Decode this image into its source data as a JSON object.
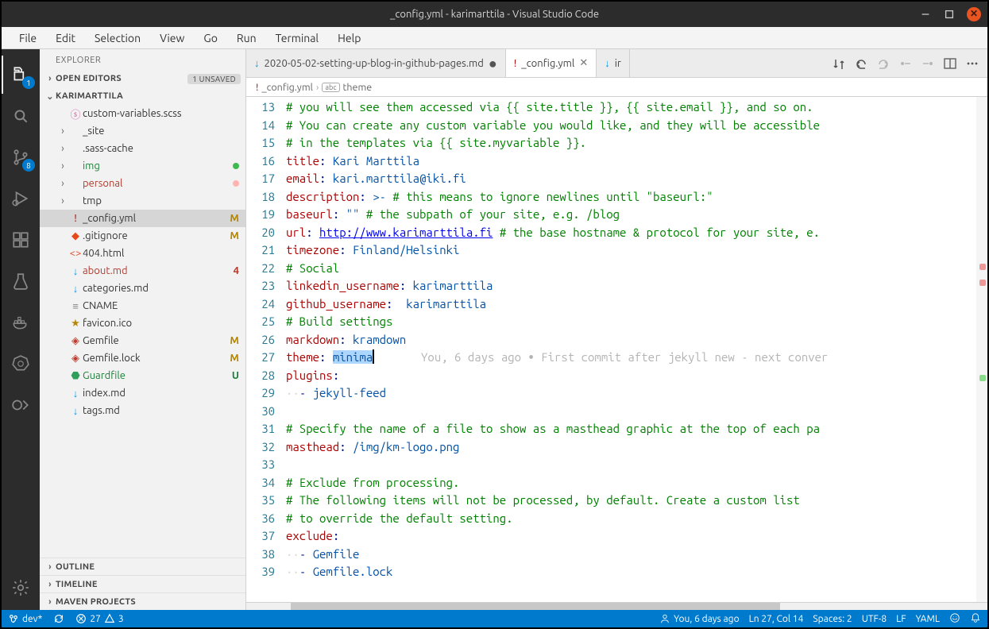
{
  "window_title": "_config.yml - karimarttila - Visual Studio Code",
  "menubar": [
    "File",
    "Edit",
    "Selection",
    "View",
    "Go",
    "Run",
    "Terminal",
    "Help"
  ],
  "activitybar": {
    "items": [
      {
        "name": "explorer",
        "badge": "1",
        "active": true
      },
      {
        "name": "search"
      },
      {
        "name": "scm",
        "badge": "8"
      },
      {
        "name": "run-debug"
      },
      {
        "name": "extensions"
      },
      {
        "name": "testing"
      },
      {
        "name": "docker"
      },
      {
        "name": "kubernetes"
      },
      {
        "name": "live-share"
      }
    ],
    "bottom_item": {
      "name": "settings"
    }
  },
  "explorer": {
    "title": "EXPLORER",
    "open_editors": {
      "label": "OPEN EDITORS",
      "badge": "1 UNSAVED"
    },
    "repo_header": "KARIMARTTILA",
    "files": [
      {
        "depth": 1,
        "kind": "file",
        "label": "custom-variables.scss",
        "icon": "sass",
        "color": ""
      },
      {
        "depth": 1,
        "kind": "folder",
        "label": "_site",
        "collapsed": true
      },
      {
        "depth": 1,
        "kind": "folder",
        "label": ".sass-cache",
        "collapsed": true
      },
      {
        "depth": 1,
        "kind": "folder",
        "label": "img",
        "collapsed": true,
        "tint": "green",
        "dot": "green"
      },
      {
        "depth": 1,
        "kind": "folder",
        "label": "personal",
        "collapsed": true,
        "tint": "red",
        "dot": "red"
      },
      {
        "depth": 1,
        "kind": "folder",
        "label": "tmp",
        "collapsed": true
      },
      {
        "depth": 1,
        "kind": "file",
        "label": "_config.yml",
        "icon": "yaml",
        "status": "M",
        "mod": true,
        "selected": true
      },
      {
        "depth": 1,
        "kind": "file",
        "label": ".gitignore",
        "icon": "git",
        "status": "M",
        "mod": true
      },
      {
        "depth": 1,
        "kind": "file",
        "label": "404.html",
        "icon": "html"
      },
      {
        "depth": 1,
        "kind": "file",
        "label": "about.md",
        "icon": "md",
        "status": "4",
        "tint": "red",
        "red": true
      },
      {
        "depth": 1,
        "kind": "file",
        "label": "categories.md",
        "icon": "md"
      },
      {
        "depth": 1,
        "kind": "file",
        "label": "CNAME",
        "icon": "text"
      },
      {
        "depth": 1,
        "kind": "file",
        "label": "favicon.ico",
        "icon": "star"
      },
      {
        "depth": 1,
        "kind": "file",
        "label": "Gemfile",
        "icon": "ruby",
        "status": "M",
        "mod": true
      },
      {
        "depth": 1,
        "kind": "file",
        "label": "Gemfile.lock",
        "icon": "ruby",
        "status": "M",
        "mod": true
      },
      {
        "depth": 1,
        "kind": "file",
        "label": "Guardfile",
        "icon": "guard",
        "status": "U",
        "tint": "green",
        "untracked": true
      },
      {
        "depth": 1,
        "kind": "file",
        "label": "index.md",
        "icon": "md"
      },
      {
        "depth": 1,
        "kind": "file",
        "label": "tags.md",
        "icon": "md"
      }
    ],
    "bottom_sections": [
      "OUTLINE",
      "TIMELINE",
      "MAVEN PROJECTS"
    ]
  },
  "tabs": {
    "items": [
      {
        "icon": "md",
        "label": "2020-05-02-setting-up-blog-in-github-pages.md",
        "dirty": true,
        "active": false
      },
      {
        "icon": "yaml",
        "label": "_config.yml",
        "dirty": false,
        "active": true,
        "closeable": true
      },
      {
        "icon": "md",
        "label": "ir",
        "partial": true,
        "active": false
      }
    ],
    "actions": [
      "git-compare",
      "undo",
      "redo-dim",
      "prev-dim",
      "next-dim",
      "split",
      "more"
    ]
  },
  "breadcrumb": {
    "file": "_config.yml",
    "node": "theme"
  },
  "editor": {
    "first_line": 13,
    "lines": [
      [
        {
          "c": "comment",
          "t": "# you will see them accessed via {{ site.title }}, {{ site.email }}, and so on."
        }
      ],
      [
        {
          "c": "comment",
          "t": "# You can create any custom variable you would like, and they will be accessible"
        }
      ],
      [
        {
          "c": "comment",
          "t": "# in the templates via {{ site.myvariable }}."
        }
      ],
      [
        {
          "c": "key",
          "t": "title"
        },
        {
          "c": "plain",
          "t": ": "
        },
        {
          "c": "str",
          "t": "Kari Marttila"
        }
      ],
      [
        {
          "c": "key",
          "t": "email"
        },
        {
          "c": "plain",
          "t": ": "
        },
        {
          "c": "str",
          "t": "kari.marttila@iki.fi"
        }
      ],
      [
        {
          "c": "key",
          "t": "description"
        },
        {
          "c": "plain",
          "t": ": "
        },
        {
          "c": "str",
          "t": ">- "
        },
        {
          "c": "comment",
          "t": "# this means to ignore newlines until \"baseurl:\""
        }
      ],
      [
        {
          "c": "key",
          "t": "baseurl"
        },
        {
          "c": "plain",
          "t": ": "
        },
        {
          "c": "str",
          "t": "\"\" "
        },
        {
          "c": "comment",
          "t": "# the subpath of your site, e.g. /blog"
        }
      ],
      [
        {
          "c": "key",
          "t": "url"
        },
        {
          "c": "plain",
          "t": ": "
        },
        {
          "c": "link",
          "t": "http://www.karimarttila.fi"
        },
        {
          "c": "plain",
          "t": " "
        },
        {
          "c": "comment",
          "t": "# the base hostname & protocol for your site, e."
        }
      ],
      [
        {
          "c": "key",
          "t": "timezone"
        },
        {
          "c": "plain",
          "t": ": "
        },
        {
          "c": "str",
          "t": "Finland/Helsinki"
        }
      ],
      [
        {
          "c": "comment",
          "t": "# Social"
        }
      ],
      [
        {
          "c": "key",
          "t": "linkedin_username"
        },
        {
          "c": "plain",
          "t": ": "
        },
        {
          "c": "str",
          "t": "karimarttila"
        }
      ],
      [
        {
          "c": "key",
          "t": "github_username"
        },
        {
          "c": "plain",
          "t": ":  "
        },
        {
          "c": "str",
          "t": "karimarttila"
        }
      ],
      [
        {
          "c": "comment",
          "t": "# Build settings"
        }
      ],
      [
        {
          "c": "key",
          "t": "markdown"
        },
        {
          "c": "plain",
          "t": ": "
        },
        {
          "c": "str",
          "t": "kramdown"
        }
      ],
      [
        {
          "c": "key",
          "t": "theme"
        },
        {
          "c": "plain",
          "t": ": "
        },
        {
          "c": "sel",
          "t": "minima"
        },
        {
          "c": "cursor",
          "t": ""
        },
        {
          "c": "faint",
          "t": "       You, 6 days ago • First commit after jekyll new - next conver"
        }
      ],
      [
        {
          "c": "key",
          "t": "plugins"
        },
        {
          "c": "plain",
          "t": ":"
        }
      ],
      [
        {
          "c": "ws",
          "t": "··"
        },
        {
          "c": "plain",
          "t": "- "
        },
        {
          "c": "str",
          "t": "jekyll-feed"
        }
      ],
      [],
      [
        {
          "c": "comment",
          "t": "# Specify the name of a file to show as a masthead graphic at the top of each pa"
        }
      ],
      [
        {
          "c": "key",
          "t": "masthead"
        },
        {
          "c": "plain",
          "t": ": "
        },
        {
          "c": "str",
          "t": "/img/km-logo.png"
        }
      ],
      [],
      [
        {
          "c": "comment",
          "t": "# Exclude from processing."
        }
      ],
      [
        {
          "c": "comment",
          "t": "# The following items will not be processed, by default. Create a custom list"
        }
      ],
      [
        {
          "c": "comment",
          "t": "# to override the default setting."
        }
      ],
      [
        {
          "c": "key",
          "t": "exclude"
        },
        {
          "c": "plain",
          "t": ":"
        }
      ],
      [
        {
          "c": "ws",
          "t": "··"
        },
        {
          "c": "plain",
          "t": "- "
        },
        {
          "c": "str",
          "t": "Gemfile"
        }
      ],
      [
        {
          "c": "ws",
          "t": "··"
        },
        {
          "c": "plain",
          "t": "- "
        },
        {
          "c": "str",
          "t": "Gemfile.lock"
        }
      ]
    ],
    "hscroll": {
      "thumb_left_pct": 6,
      "thumb_width_pct": 66
    }
  },
  "statusbar": {
    "left": {
      "branch": "dev*",
      "sync_icon": true,
      "errors": "27",
      "warnings": "3"
    },
    "right": {
      "blame": "You, 6 days ago",
      "position": "Ln 27, Col 14",
      "spaces": "Spaces: 2",
      "encoding": "UTF-8",
      "eol": "LF",
      "lang": "YAML",
      "feedback": true,
      "bell": true
    }
  },
  "icons": {
    "md": "↓",
    "yaml": "!",
    "sass": "ⓢ",
    "git": "◆",
    "html": "<>",
    "text": "≡",
    "star": "★",
    "ruby": "◈",
    "guard": "⬣"
  },
  "colors": {
    "md": "#0099e5",
    "yaml": "#aa0000",
    "sass": "#cf649a",
    "git": "#e64a19",
    "html": "#e44d26",
    "text": "#888",
    "star": "#b8860b",
    "ruby": "#c0392b",
    "guard": "#309f5b"
  }
}
